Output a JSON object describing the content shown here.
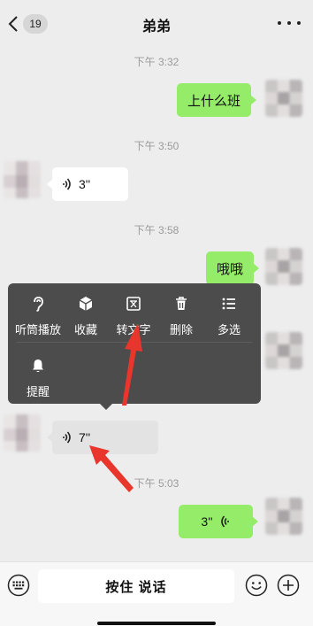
{
  "header": {
    "badge": "19",
    "title": "弟弟"
  },
  "messages": [
    {
      "time": "下午 3:32",
      "side": "me",
      "text": "上什么班"
    },
    {
      "time": "下午 3:50",
      "side": "other",
      "duration": "3''"
    },
    {
      "time": "下午 3:58",
      "side": "me",
      "text": "哦哦"
    },
    {
      "side": "other",
      "duration": "7''"
    },
    {
      "time": "下午 5:03",
      "side": "me",
      "duration": "3''"
    }
  ],
  "context_menu": {
    "items": [
      {
        "label": "听筒播放",
        "icon": "ear-icon"
      },
      {
        "label": "收藏",
        "icon": "cube-icon"
      },
      {
        "label": "转文字",
        "icon": "text-convert-icon"
      },
      {
        "label": "删除",
        "icon": "trash-icon"
      },
      {
        "label": "多选",
        "icon": "multiselect-icon"
      },
      {
        "label": "提醒",
        "icon": "bell-icon"
      }
    ]
  },
  "annotations": {
    "color": "#e8362c"
  },
  "footer": {
    "talk_label": "按住 说话"
  },
  "colors": {
    "background": "#ededed",
    "my_bubble": "#95ec69",
    "their_bubble": "#ffffff",
    "menu_bg": "#4c4c4c"
  }
}
